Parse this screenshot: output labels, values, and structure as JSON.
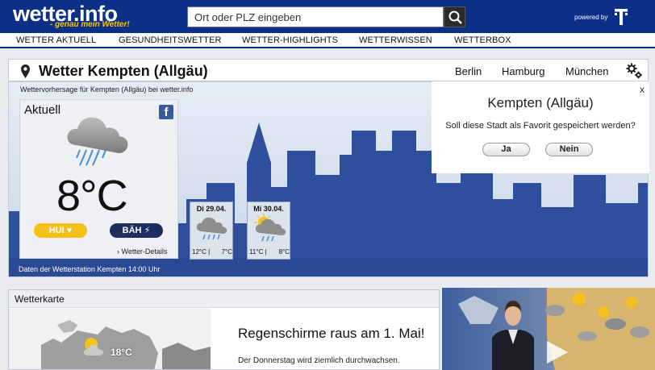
{
  "header": {
    "logo": "wetter.info",
    "tagline": "- genau mein Wetter!",
    "search_placeholder": "Ort oder PLZ eingeben",
    "powered_by": "powered by",
    "brand_color": "#0c2f87"
  },
  "nav": {
    "items": [
      "WETTER AKTUELL",
      "GESUNDHEITSWETTER",
      "WETTER-HIGHLIGHTS",
      "WETTERWISSEN",
      "WETTERBOX"
    ]
  },
  "location": {
    "title": "Wetter Kempten (Allgäu)",
    "cities": [
      "Berlin",
      "Hamburg",
      "München"
    ]
  },
  "forecast": {
    "subtitle": "Wettervorhersage für Kempten (Allgäu) bei wetter.info",
    "current_label": "Aktuell",
    "temperature": "8°C",
    "condition_icon": "rain-cloud-icon",
    "hui_label": "HUI",
    "bah_label": "BÄH",
    "details_link": "› Wetter-Details",
    "station_text": "Daten der Wetterstation Kempten 14:00 Uhr",
    "days": [
      {
        "date": "Di 29.04.",
        "min": "12°C",
        "max": "7°C",
        "icon": "cloud-rain-icon"
      },
      {
        "date": "Mi 30.04.",
        "min": "11°C",
        "max": "8°C",
        "icon": "sun-cloud-rain-icon"
      }
    ]
  },
  "popup": {
    "close": "x",
    "city": "Kempten (Allgäu)",
    "question": "Soll diese Stadt als Favorit gespeichert werden?",
    "yes": "Ja",
    "no": "Nein"
  },
  "map": {
    "section_title": "Wetterkarte",
    "map_temp": "18°C",
    "headline": "Regenschirme raus am 1. Mai!",
    "teaser": "Der Donnerstag wird ziemlich durchwachsen."
  }
}
